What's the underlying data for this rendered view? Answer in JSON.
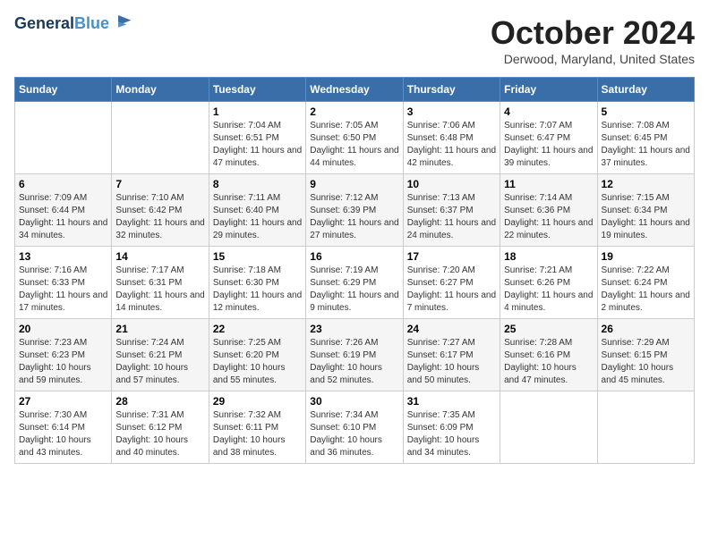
{
  "logo": {
    "line1": "General",
    "line2": "Blue"
  },
  "title": "October 2024",
  "location": "Derwood, Maryland, United States",
  "weekdays": [
    "Sunday",
    "Monday",
    "Tuesday",
    "Wednesday",
    "Thursday",
    "Friday",
    "Saturday"
  ],
  "weeks": [
    [
      {
        "day": "",
        "sunrise": "",
        "sunset": "",
        "daylight": ""
      },
      {
        "day": "",
        "sunrise": "",
        "sunset": "",
        "daylight": ""
      },
      {
        "day": "1",
        "sunrise": "Sunrise: 7:04 AM",
        "sunset": "Sunset: 6:51 PM",
        "daylight": "Daylight: 11 hours and 47 minutes."
      },
      {
        "day": "2",
        "sunrise": "Sunrise: 7:05 AM",
        "sunset": "Sunset: 6:50 PM",
        "daylight": "Daylight: 11 hours and 44 minutes."
      },
      {
        "day": "3",
        "sunrise": "Sunrise: 7:06 AM",
        "sunset": "Sunset: 6:48 PM",
        "daylight": "Daylight: 11 hours and 42 minutes."
      },
      {
        "day": "4",
        "sunrise": "Sunrise: 7:07 AM",
        "sunset": "Sunset: 6:47 PM",
        "daylight": "Daylight: 11 hours and 39 minutes."
      },
      {
        "day": "5",
        "sunrise": "Sunrise: 7:08 AM",
        "sunset": "Sunset: 6:45 PM",
        "daylight": "Daylight: 11 hours and 37 minutes."
      }
    ],
    [
      {
        "day": "6",
        "sunrise": "Sunrise: 7:09 AM",
        "sunset": "Sunset: 6:44 PM",
        "daylight": "Daylight: 11 hours and 34 minutes."
      },
      {
        "day": "7",
        "sunrise": "Sunrise: 7:10 AM",
        "sunset": "Sunset: 6:42 PM",
        "daylight": "Daylight: 11 hours and 32 minutes."
      },
      {
        "day": "8",
        "sunrise": "Sunrise: 7:11 AM",
        "sunset": "Sunset: 6:40 PM",
        "daylight": "Daylight: 11 hours and 29 minutes."
      },
      {
        "day": "9",
        "sunrise": "Sunrise: 7:12 AM",
        "sunset": "Sunset: 6:39 PM",
        "daylight": "Daylight: 11 hours and 27 minutes."
      },
      {
        "day": "10",
        "sunrise": "Sunrise: 7:13 AM",
        "sunset": "Sunset: 6:37 PM",
        "daylight": "Daylight: 11 hours and 24 minutes."
      },
      {
        "day": "11",
        "sunrise": "Sunrise: 7:14 AM",
        "sunset": "Sunset: 6:36 PM",
        "daylight": "Daylight: 11 hours and 22 minutes."
      },
      {
        "day": "12",
        "sunrise": "Sunrise: 7:15 AM",
        "sunset": "Sunset: 6:34 PM",
        "daylight": "Daylight: 11 hours and 19 minutes."
      }
    ],
    [
      {
        "day": "13",
        "sunrise": "Sunrise: 7:16 AM",
        "sunset": "Sunset: 6:33 PM",
        "daylight": "Daylight: 11 hours and 17 minutes."
      },
      {
        "day": "14",
        "sunrise": "Sunrise: 7:17 AM",
        "sunset": "Sunset: 6:31 PM",
        "daylight": "Daylight: 11 hours and 14 minutes."
      },
      {
        "day": "15",
        "sunrise": "Sunrise: 7:18 AM",
        "sunset": "Sunset: 6:30 PM",
        "daylight": "Daylight: 11 hours and 12 minutes."
      },
      {
        "day": "16",
        "sunrise": "Sunrise: 7:19 AM",
        "sunset": "Sunset: 6:29 PM",
        "daylight": "Daylight: 11 hours and 9 minutes."
      },
      {
        "day": "17",
        "sunrise": "Sunrise: 7:20 AM",
        "sunset": "Sunset: 6:27 PM",
        "daylight": "Daylight: 11 hours and 7 minutes."
      },
      {
        "day": "18",
        "sunrise": "Sunrise: 7:21 AM",
        "sunset": "Sunset: 6:26 PM",
        "daylight": "Daylight: 11 hours and 4 minutes."
      },
      {
        "day": "19",
        "sunrise": "Sunrise: 7:22 AM",
        "sunset": "Sunset: 6:24 PM",
        "daylight": "Daylight: 11 hours and 2 minutes."
      }
    ],
    [
      {
        "day": "20",
        "sunrise": "Sunrise: 7:23 AM",
        "sunset": "Sunset: 6:23 PM",
        "daylight": "Daylight: 10 hours and 59 minutes."
      },
      {
        "day": "21",
        "sunrise": "Sunrise: 7:24 AM",
        "sunset": "Sunset: 6:21 PM",
        "daylight": "Daylight: 10 hours and 57 minutes."
      },
      {
        "day": "22",
        "sunrise": "Sunrise: 7:25 AM",
        "sunset": "Sunset: 6:20 PM",
        "daylight": "Daylight: 10 hours and 55 minutes."
      },
      {
        "day": "23",
        "sunrise": "Sunrise: 7:26 AM",
        "sunset": "Sunset: 6:19 PM",
        "daylight": "Daylight: 10 hours and 52 minutes."
      },
      {
        "day": "24",
        "sunrise": "Sunrise: 7:27 AM",
        "sunset": "Sunset: 6:17 PM",
        "daylight": "Daylight: 10 hours and 50 minutes."
      },
      {
        "day": "25",
        "sunrise": "Sunrise: 7:28 AM",
        "sunset": "Sunset: 6:16 PM",
        "daylight": "Daylight: 10 hours and 47 minutes."
      },
      {
        "day": "26",
        "sunrise": "Sunrise: 7:29 AM",
        "sunset": "Sunset: 6:15 PM",
        "daylight": "Daylight: 10 hours and 45 minutes."
      }
    ],
    [
      {
        "day": "27",
        "sunrise": "Sunrise: 7:30 AM",
        "sunset": "Sunset: 6:14 PM",
        "daylight": "Daylight: 10 hours and 43 minutes."
      },
      {
        "day": "28",
        "sunrise": "Sunrise: 7:31 AM",
        "sunset": "Sunset: 6:12 PM",
        "daylight": "Daylight: 10 hours and 40 minutes."
      },
      {
        "day": "29",
        "sunrise": "Sunrise: 7:32 AM",
        "sunset": "Sunset: 6:11 PM",
        "daylight": "Daylight: 10 hours and 38 minutes."
      },
      {
        "day": "30",
        "sunrise": "Sunrise: 7:34 AM",
        "sunset": "Sunset: 6:10 PM",
        "daylight": "Daylight: 10 hours and 36 minutes."
      },
      {
        "day": "31",
        "sunrise": "Sunrise: 7:35 AM",
        "sunset": "Sunset: 6:09 PM",
        "daylight": "Daylight: 10 hours and 34 minutes."
      },
      {
        "day": "",
        "sunrise": "",
        "sunset": "",
        "daylight": ""
      },
      {
        "day": "",
        "sunrise": "",
        "sunset": "",
        "daylight": ""
      }
    ]
  ]
}
